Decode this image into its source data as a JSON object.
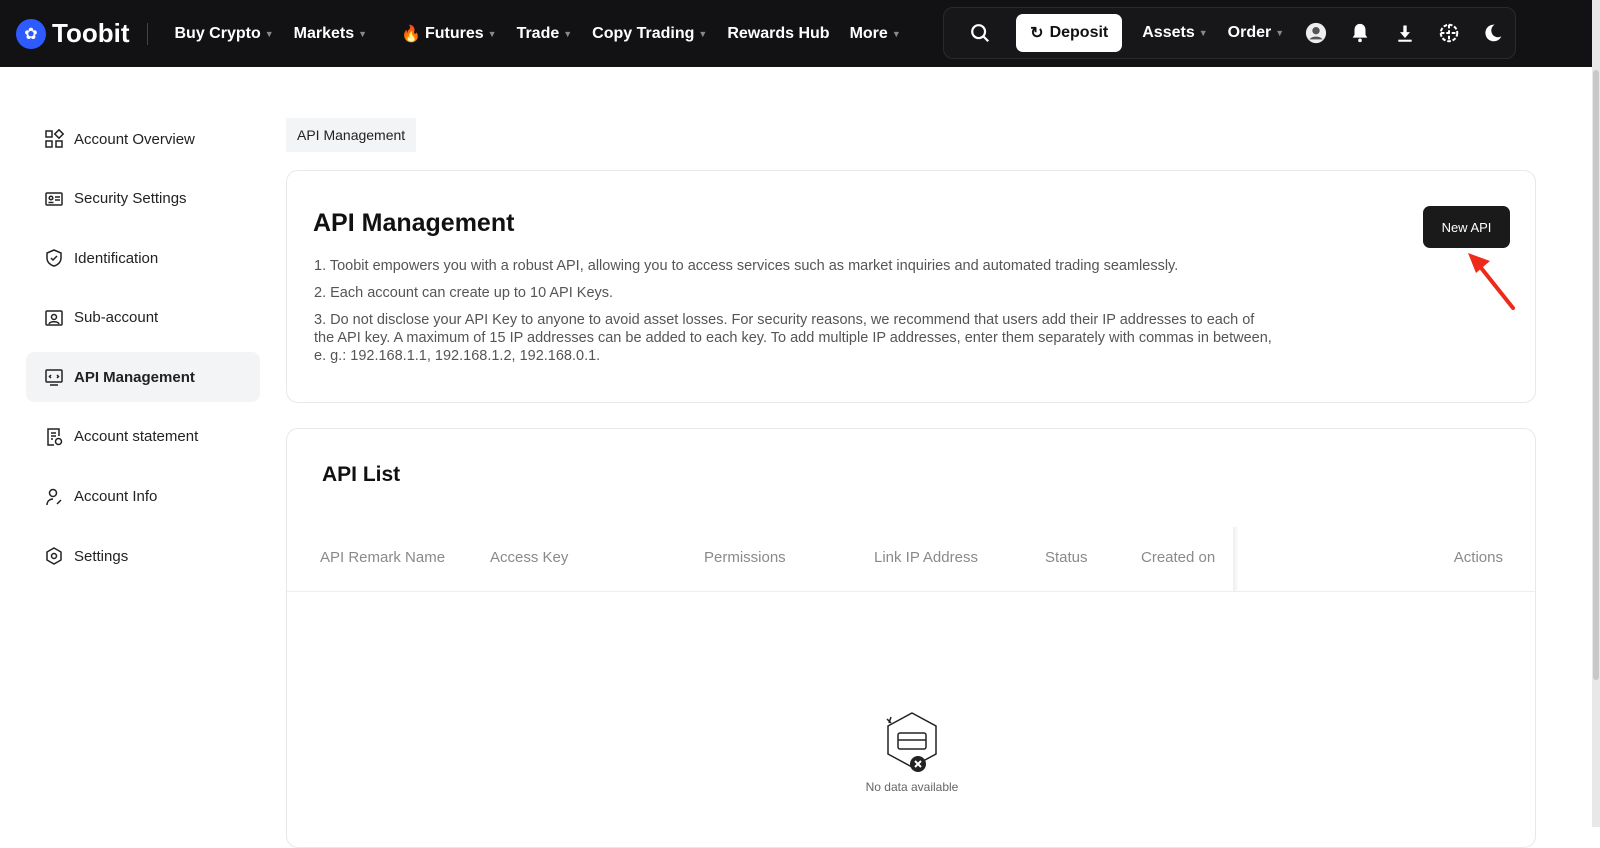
{
  "header": {
    "logo": "Toobit",
    "nav": [
      {
        "label": "Buy Crypto",
        "caret": true
      },
      {
        "label": "Markets",
        "caret": true
      },
      {
        "label": "Futures",
        "caret": true,
        "icon": "🔥"
      },
      {
        "label": "Trade",
        "caret": true
      },
      {
        "label": "Copy Trading",
        "caret": true
      },
      {
        "label": "Rewards Hub",
        "caret": false
      },
      {
        "label": "More",
        "caret": true
      }
    ],
    "deposit": "Deposit",
    "assets": "Assets",
    "order": "Order"
  },
  "sidebar": {
    "items": [
      {
        "label": "Account Overview"
      },
      {
        "label": "Security Settings"
      },
      {
        "label": "Identification"
      },
      {
        "label": "Sub-account"
      },
      {
        "label": "API Management",
        "active": true
      },
      {
        "label": "Account statement"
      },
      {
        "label": "Account Info"
      },
      {
        "label": "Settings"
      }
    ]
  },
  "breadcrumb": "API Management",
  "main": {
    "title": "API Management",
    "new_api": "New API",
    "notes": [
      "1. Toobit empowers you with a robust API, allowing you to access services such as market inquiries and automated trading seamlessly.",
      "2. Each account can create up to 10 API Keys.",
      "3. Do not disclose your API Key to anyone to avoid asset losses. For security reasons, we recommend that users add their IP addresses to each of the API key. A maximum of 15 IP addresses can be added to each key. To add multiple IP addresses, enter them separately with commas in between, e. g.:  192.168.1.1, 192.168.1.2, 192.168.0.1."
    ]
  },
  "api_list": {
    "title": "API List",
    "columns": [
      "API Remark Name",
      "Access Key",
      "Permissions",
      "Link IP Address",
      "Status",
      "Created on",
      "Actions"
    ],
    "empty": "No data available"
  },
  "colors": {
    "accent": "#2e5bff",
    "topbar": "#121214",
    "arrow": "#ee2b1a"
  }
}
